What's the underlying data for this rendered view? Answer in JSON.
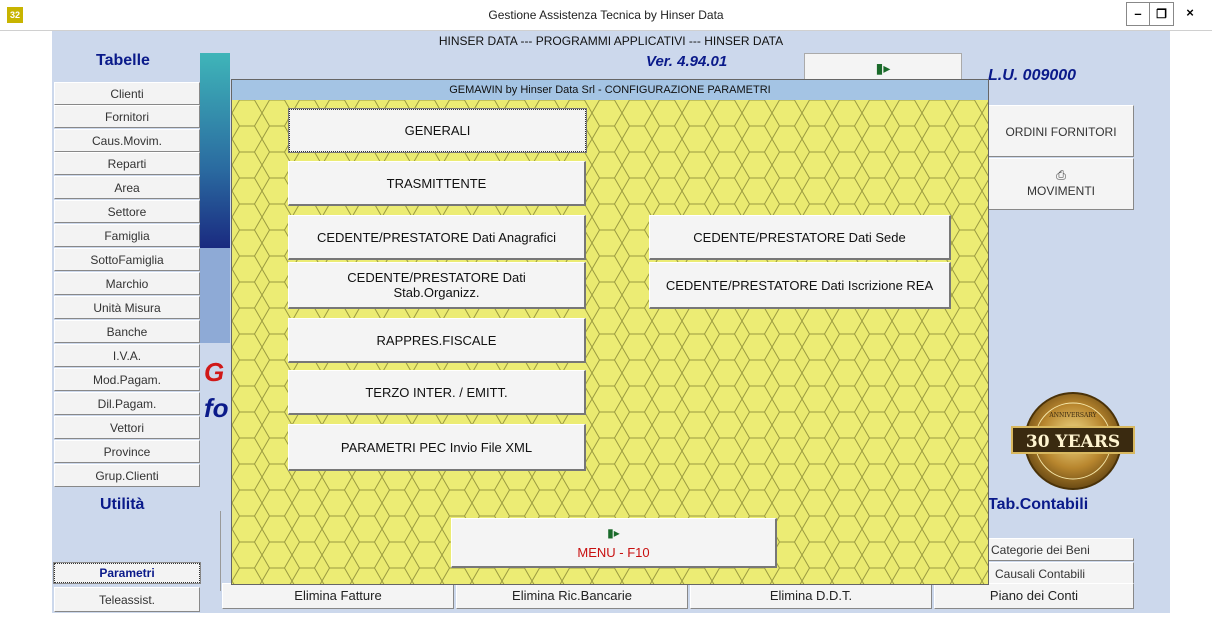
{
  "window": {
    "app_icon": "32",
    "title": "Gestione Assistenza Tecnica by Hinser Data",
    "min_icon": "minimize-icon",
    "max_icon": "maximize-icon",
    "close_icon": "close-icon"
  },
  "main": {
    "banner": "HINSER DATA --- PROGRAMMI APPLICATIVI --- HINSER DATA",
    "version": "Ver. 4.94.01",
    "lu": "L.U. 009000",
    "big_g": "G",
    "big_f": "fo"
  },
  "sidebar": {
    "tabelle_heading": "Tabelle",
    "items": [
      "Clienti",
      "Fornitori",
      "Caus.Movim.",
      "Reparti",
      "Area",
      "Settore",
      "Famiglia",
      "SottoFamiglia",
      "Marchio",
      "Unità Misura",
      "Banche",
      "I.V.A.",
      "Mod.Pagam.",
      "Dil.Pagam.",
      "Vettori",
      "Province",
      "Grup.Clienti"
    ],
    "utilita_heading": "Utilità",
    "parametri": "Parametri",
    "teleassist": "Teleassist."
  },
  "right": {
    "ordini_fornitori": "ORDINI FORNITORI",
    "movimenti_icon": "printer-icon",
    "movimenti": "MOVIMENTI",
    "badge_text": "30 YEARS",
    "badge_top": "ANNIVERSARY",
    "tab_contabili": "Tab.Contabili",
    "categorie_beni": "Categorie dei Beni",
    "causali_contabili": "Causali Contabili",
    "piano_conti": "Piano dei Conti"
  },
  "bottom": {
    "elimina_fatture": "Elimina Fatture",
    "elimina_ric": "Elimina Ric.Bancarie",
    "elimina_ddt": "Elimina D.D.T."
  },
  "dialog": {
    "title": "GEMAWIN by Hinser Data Srl - CONFIGURAZIONE PARAMETRI",
    "generali": "GENERALI",
    "trasmittente": "TRASMITTENTE",
    "cedente_anagrafici": "CEDENTE/PRESTATORE  Dati Anagrafici",
    "cedente_sede": "CEDENTE/PRESTATORE  Dati Sede",
    "cedente_stab": "CEDENTE/PRESTATORE  Dati Stab.Organizz.",
    "cedente_rea": "CEDENTE/PRESTATORE  Dati Iscrizione REA",
    "rappres": "RAPPRES.FISCALE",
    "terzo": "TERZO INTER. / EMITT.",
    "pec": "PARAMETRI PEC Invio File XML",
    "menu": "MENU - F10",
    "menu_icon": "exit-door-icon"
  },
  "colors": {
    "accent": "#0a1a8a",
    "dialog_bg": "#eaea70",
    "dialog_title_bg": "#a4c4e4",
    "main_bg": "#ccd8ec",
    "red": "#d01818"
  }
}
